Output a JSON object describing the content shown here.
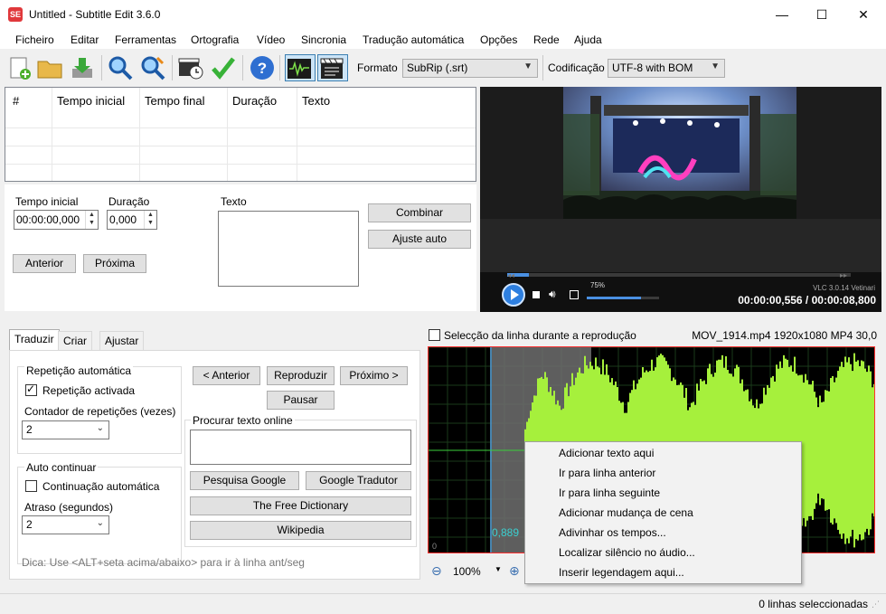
{
  "app": {
    "icon_text": "SE",
    "title": "Untitled - Subtitle Edit 3.6.0"
  },
  "window_controls": {
    "minimize": "—",
    "maximize": "☐",
    "close": "✕"
  },
  "menu": [
    "Ficheiro",
    "Editar",
    "Ferramentas",
    "Ortografia",
    "Vídeo",
    "Sincronia",
    "Tradução automática",
    "Opções",
    "Rede",
    "Ajuda"
  ],
  "toolbar": {
    "format_label": "Formato",
    "format_value": "SubRip (.srt)",
    "encoding_label": "Codificação",
    "encoding_value": "UTF-8 with BOM",
    "icons": [
      "new-file-icon",
      "open-folder-icon",
      "download-icon",
      "find-icon",
      "replace-icon",
      "visual-sync-icon",
      "spell-check-icon",
      "help-icon",
      "waveform-toggle-icon",
      "video-toggle-icon"
    ]
  },
  "grid": {
    "columns": [
      "#",
      "Tempo inicial",
      "Tempo final",
      "Duração",
      "Texto"
    ]
  },
  "edit": {
    "start_label": "Tempo inicial",
    "start_value": "00:00:00,000",
    "duration_label": "Duração",
    "duration_value": "0,000",
    "text_label": "Texto",
    "combine_button": "Combinar",
    "auto_adjust_button": "Ajuste auto",
    "prev_button": "Anterior",
    "next_button": "Próxima"
  },
  "player": {
    "volume": "75%",
    "version": "VLC 3.0.14 Vetinari",
    "time": "00:00:00,556 / 00:00:08,800",
    "volume_level": 0.75,
    "progress": 0.063
  },
  "tabs": [
    "Traduzir",
    "Criar",
    "Ajustar"
  ],
  "translate": {
    "auto_repeat_group": "Repetição automática",
    "repeat_enabled": "Repetição activada",
    "repeat_count_label": "Contador de repetições (vezes)",
    "repeat_count_value": "2",
    "auto_continue_group": "Auto continuar",
    "continue_enabled": "Continuação automática",
    "delay_label": "Atraso (segundos)",
    "delay_value": "2",
    "prev_button": "< Anterior",
    "play_button": "Reproduzir",
    "next_button": "Próximo >",
    "pause_button": "Pausar",
    "search_online_label": "Procurar texto online",
    "google_search_button": "Pesquisa Google",
    "google_translate_button": "Google Tradutor",
    "free_dictionary_button": "The Free Dictionary",
    "wikipedia_button": "Wikipedia",
    "tip": "Dica: Use <ALT+seta acima/abaixo> para ir à linha ant/seg"
  },
  "waveform": {
    "select_during_playback": "Selecção da linha durante a reprodução",
    "video_info": "MOV_1914.mp4 1920x1080 MP4 30,0",
    "zoom_value": "100%",
    "position_label": "0,889",
    "zero_label": "0",
    "wave_color": "#a6f03c"
  },
  "context_menu": [
    "Adicionar texto aqui",
    "Ir para linha anterior",
    "Ir para linha seguinte",
    "Adicionar mudança de cena",
    "Adivinhar os tempos...",
    "Localizar silêncio no áudio...",
    "Inserir legendagem aqui..."
  ],
  "status": {
    "selected": "0 linhas seleccionadas"
  }
}
